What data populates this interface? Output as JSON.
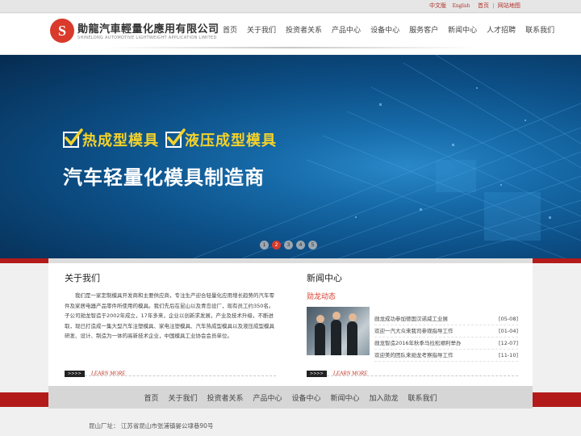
{
  "topbar": {
    "lang_cn": "中文版",
    "lang_en": "English",
    "home": "首页",
    "sep": "|",
    "sitemap": "网站地图"
  },
  "logo": {
    "mark": "S",
    "name_cn": "勛龍汽車輕量化應用有限公司",
    "name_en": "SHINELONG AUTOMOTIVE LIGHTWEIGHT APPLICATION LIMITED"
  },
  "nav": [
    "首页",
    "关于我们",
    "投资者关系",
    "产品中心",
    "设备中心",
    "服务客户",
    "新闻中心",
    "人才招聘",
    "联系我们"
  ],
  "banner": {
    "feature1": "热成型模具",
    "feature2": "液压成型模具",
    "tagline": "汽车轻量化模具制造商",
    "dots": [
      "1",
      "2",
      "3",
      "4",
      "5"
    ],
    "active_dot": 2
  },
  "about": {
    "title": "关于我们",
    "text": "我们是一家定制模具开发商和主要供应商，专注生产迎合轻量化应用增长趋势的汽车零件及家居电器产品零件所使用的模具。我们先后在昆山以及青岛设厂，现有员工约350名。子公司勋龙智造于2002年成立，17年多来，企业以创新求发展，产业及技术升级，不断进取，现已打造成一集大型汽车注塑模具、家电注塑模具、汽车热成型模具以及液压成型模具研发、设计、制造为一体的高新技术企业，中国模具工业协会会员单位。",
    "learn_arrow": ">>>>",
    "learn_more": "LEARN MORE"
  },
  "news": {
    "title": "新闻中心",
    "subtitle": "勋龙动态",
    "items": [
      {
        "title": "勋龙成功参加德国汉诺威工业展",
        "date": "[05-08]"
      },
      {
        "title": "欢迎一汽大众来我司参观指导工作",
        "date": "[01-04]"
      },
      {
        "title": "勋龙智造2016年秋季马拉松顺利举办",
        "date": "[12-07]"
      },
      {
        "title": "欢迎美的团队来勋龙考察指导工作",
        "date": "[11-10]"
      }
    ],
    "learn_arrow": ">>>>",
    "learn_more": "LEARN MORE"
  },
  "footer": {
    "nav": [
      "首页",
      "关于我们",
      "投资者关系",
      "产品中心",
      "设备中心",
      "新闻中心",
      "加入勋龙",
      "联系我们"
    ],
    "address": "昆山厂址：  江苏省昆山市张浦镇晏公埭巷90号"
  },
  "colors": {
    "brand_red": "#b31b1b",
    "feature_yellow": "#f4d22a",
    "banner_blue": "#0c4e85"
  }
}
